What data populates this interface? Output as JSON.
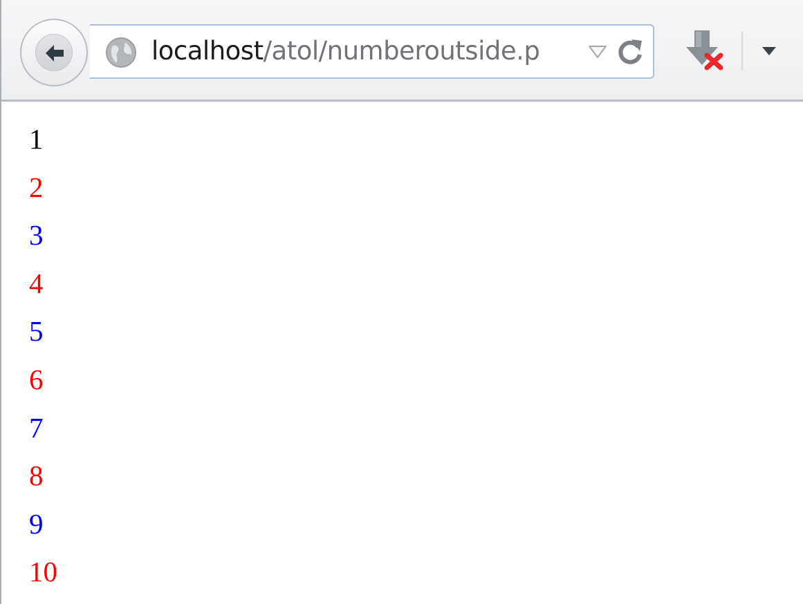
{
  "toolbar": {
    "url": {
      "host": "localhost",
      "path": "/atol/numberoutside.p"
    },
    "icons": {
      "back": "back-arrow-icon",
      "site": "globe-icon",
      "dropmarker": "chevron-down-icon",
      "reload": "reload-icon",
      "downloads": "download-icon",
      "menu": "chevron-down-icon"
    }
  },
  "page": {
    "numbers": [
      {
        "text": "1",
        "color": "#000000"
      },
      {
        "text": "2",
        "color": "#ff0000"
      },
      {
        "text": "3",
        "color": "#0000ff"
      },
      {
        "text": "4",
        "color": "#ff0000"
      },
      {
        "text": "5",
        "color": "#0000ff"
      },
      {
        "text": "6",
        "color": "#ff0000"
      },
      {
        "text": "7",
        "color": "#0000ff"
      },
      {
        "text": "8",
        "color": "#ff0000"
      },
      {
        "text": "9",
        "color": "#0000ff"
      },
      {
        "text": "10",
        "color": "#ff0000"
      }
    ]
  }
}
